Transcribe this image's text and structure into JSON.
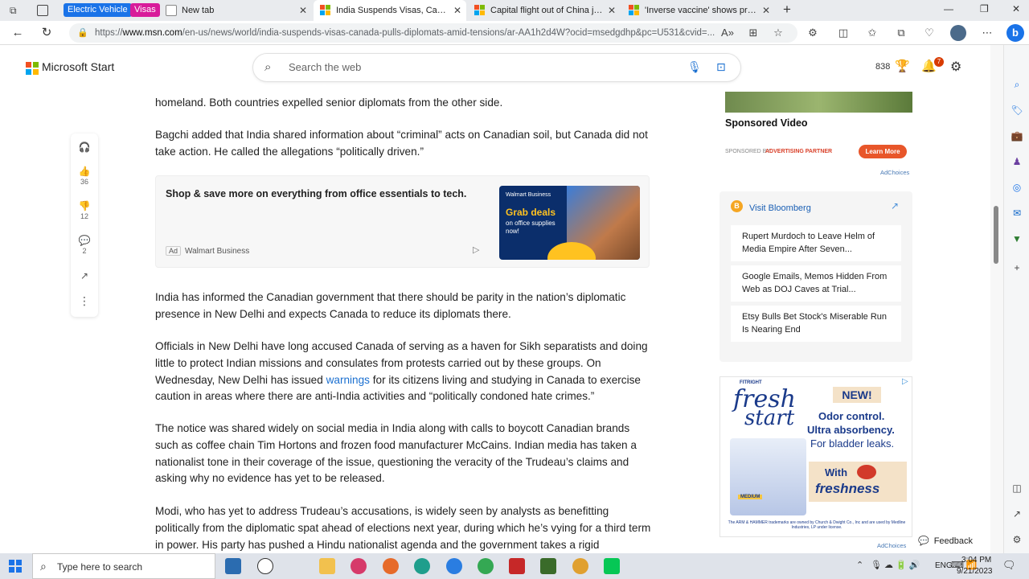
{
  "browser": {
    "tab_groups": [
      {
        "label": "Electric Vehicle",
        "color": "#1a73e8"
      },
      {
        "label": "Visas",
        "color": "#d81b9a"
      }
    ],
    "tabs": [
      {
        "title": "New tab",
        "active": false
      },
      {
        "title": "India Suspends Visas, Canada Pu",
        "active": true
      },
      {
        "title": "Capital flight out of China jumps",
        "active": false
      },
      {
        "title": "'Inverse vaccine' shows promise",
        "active": false
      }
    ],
    "url_prefix": "https://",
    "url_domain": "www.msn.com",
    "url_rest": "/en-us/news/world/india-suspends-visas-canada-pulls-diplomats-amid-tensions/ar-AA1h2d4W?ocid=msedgdhp&pc=U531&cvid=..."
  },
  "msn": {
    "brand": "Microsoft Start",
    "search_placeholder": "Search the web",
    "points": "838",
    "notification_count": "7"
  },
  "left_rail": {
    "like_count": "36",
    "dislike_count": "12",
    "comment_count": "2"
  },
  "article": {
    "p0": "homeland. Both countries expelled senior diplomats from the other side.",
    "p1": "Bagchi added that India shared information about “criminal” acts on Canadian soil, but Canada did not take action. He called the allegations “politically driven.”",
    "p2": "India has informed the Canadian government that there should be parity in the nation’s diplomatic presence in New Delhi and expects Canada to reduce its diplomats there.",
    "p3_before": "Officials in New Delhi have long accused Canada of serving as a haven for Sikh separatists and doing little to protect Indian missions and consulates from protests carried out by these groups. On Wednesday, New Delhi has issued ",
    "p3_link": "warnings",
    "p3_after": " for its citizens living and studying in Canada to exercise caution in areas where there are anti-India activities and “politically condoned hate crimes.”",
    "p4": "The notice was shared widely on social media in India along with calls to boycott Canadian brands such as coffee chain Tim Hortons and frozen food manufacturer McCains. Indian media has taken a nationalist tone in their coverage of the issue, questioning the veracity of the Trudeau’s claims and asking why no evidence has yet to be released.",
    "p5": "Modi, who has yet to address Trudeau’s accusations, is widely seen by analysts as benefitting politically from the diplomatic spat ahead of elections next year, during which he’s vying for a third term in power. His party has pushed a Hindu nationalist agenda and the government takes a rigid"
  },
  "inline_ad": {
    "headline": "Shop & save more on everything from office essentials to tech.",
    "ad_badge": "Ad",
    "advertiser": "Walmart Business",
    "image_brand": "Walmart Business",
    "image_headline": "Grab deals",
    "image_sub": "on office supplies now!"
  },
  "sponsored": {
    "title": "Sponsored Video",
    "sponsored_by": "SPONSORED BY",
    "partner": "ADVERTISING PARTNER",
    "cta": "Learn More",
    "adchoices": "AdChoices"
  },
  "bloomberg": {
    "header": "Visit Bloomberg",
    "items": [
      "Rupert Murdoch to Leave Helm of Media Empire After Seven...",
      "Google Emails, Memos Hidden From Web as DOJ Caves at Trial...",
      "Etsy Bulls Bet Stock's Miserable Run Is Nearing End"
    ]
  },
  "side_ad": {
    "brand_small": "FITRIGHT",
    "brand_main_1": "fresh",
    "brand_main_2": "start",
    "badge": "NEW!",
    "line1": "Odor control.",
    "line2": "Ultra absorbency.",
    "line3": "For bladder leaks.",
    "with": "With",
    "freshness": "freshness",
    "pkg_size": "MEDIUM",
    "fine_print": "The ARM & HAMMER trademarks are owned by Church & Dwight Co., Inc and are used by Medline Industries, LP under license.",
    "adchoices": "AdChoices"
  },
  "feedback": "Feedback",
  "taskbar": {
    "search_placeholder": "Type here to search",
    "lang": "ENG",
    "time": "3:04 PM",
    "date": "9/21/2023"
  }
}
